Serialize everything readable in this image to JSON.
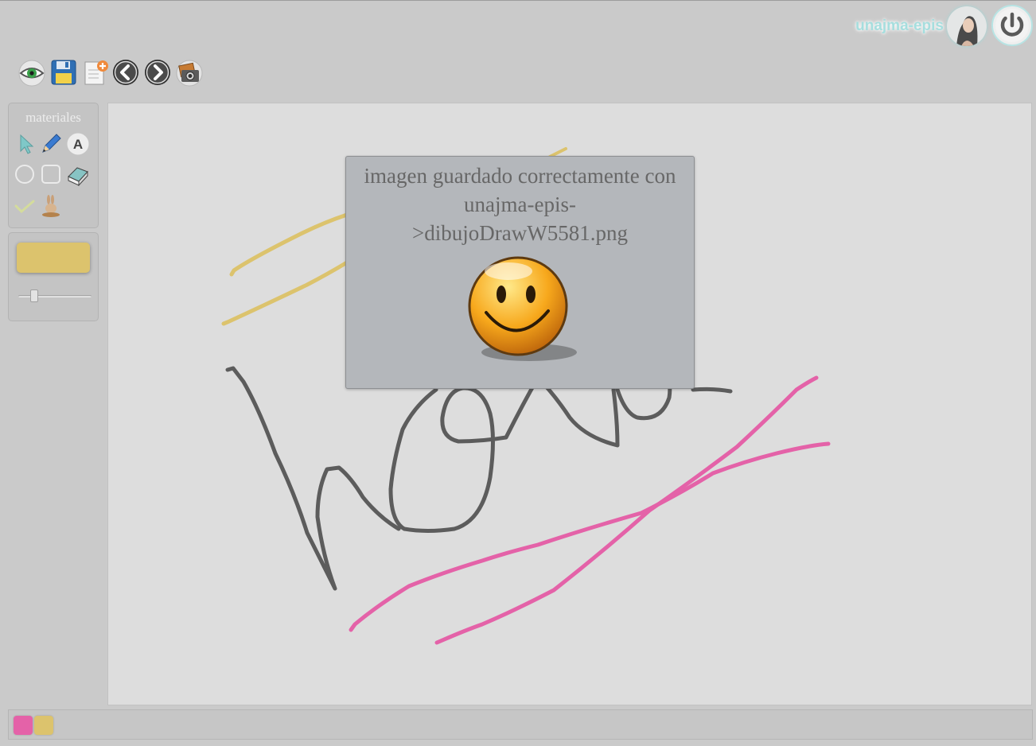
{
  "header": {
    "username": "unajma-epis",
    "avatar_icon": "user-avatar-photo",
    "power_icon": "power-icon"
  },
  "toolbar": {
    "buttons": [
      {
        "icon": "eye-icon"
      },
      {
        "icon": "save-floppy-icon"
      },
      {
        "icon": "new-document-icon"
      },
      {
        "icon": "back-arrow-icon"
      },
      {
        "icon": "forward-arrow-icon"
      },
      {
        "icon": "camera-photo-icon"
      }
    ]
  },
  "materials": {
    "title": "materiales",
    "tools": [
      "pointer-icon",
      "pencil-icon",
      "text-a-icon",
      "circle-icon",
      "rectangle-icon",
      "eraser-icon",
      "check-icon",
      "bunny-icon"
    ]
  },
  "color_panel": {
    "current_color": "#dcc36d",
    "brush_size_fraction": 0.18
  },
  "dialog": {
    "message": "imagen guardado correctamente con unajma-epis->dibujoDrawW5581.png",
    "icon": "smiley-face-icon"
  },
  "palette": {
    "colors": [
      "#e462a8",
      "#dcc36d"
    ]
  },
  "colors": {
    "stroke_dark": "#5c5c5c",
    "stroke_yellow": "#dcc36d",
    "stroke_pink": "#e462a8"
  }
}
